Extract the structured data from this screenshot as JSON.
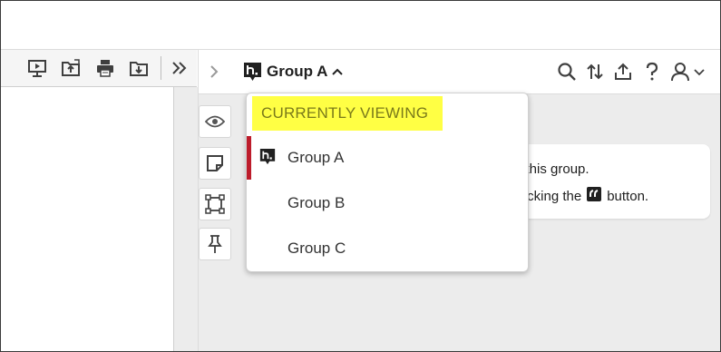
{
  "colors": {
    "accent_red": "#bd1c2b",
    "highlight_yellow": "#ffff44",
    "icon_dark": "#3f3f3f"
  },
  "left_toolbar": {
    "buttons": [
      {
        "name": "presentation-mode-icon"
      },
      {
        "name": "open-file-icon"
      },
      {
        "name": "print-icon"
      },
      {
        "name": "download-icon"
      },
      {
        "name": "more-tools-icon"
      }
    ]
  },
  "sidebar": {
    "header": {
      "group_label": "Group A",
      "icons": [
        "search-icon",
        "sort-icon",
        "share-icon",
        "help-icon",
        "user-icon",
        "chevron-down-icon"
      ]
    },
    "tools": [
      "eye-icon",
      "note-icon",
      "selection-icon",
      "pin-icon"
    ],
    "card": {
      "line1_text": "n this group.",
      "line2_prefix": "clicking the",
      "line2_suffix": "button."
    },
    "dropdown": {
      "heading": "CURRENTLY VIEWING",
      "items": [
        {
          "label": "Group A",
          "active": true
        },
        {
          "label": "Group B",
          "active": false
        },
        {
          "label": "Group C",
          "active": false
        }
      ]
    }
  }
}
